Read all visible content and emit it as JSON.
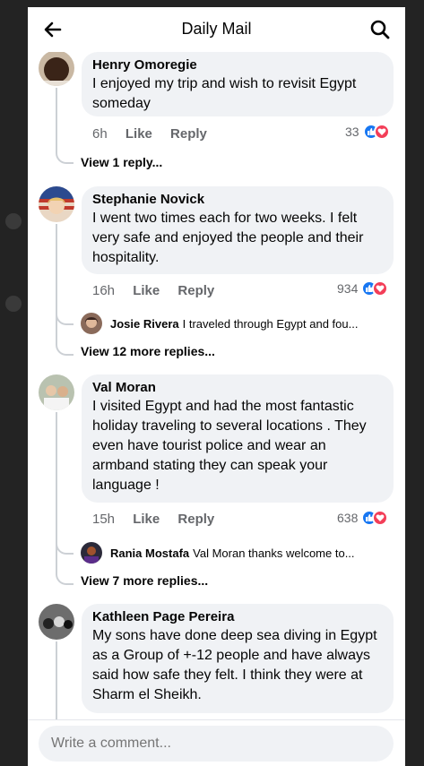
{
  "header": {
    "title": "Daily Mail",
    "back_icon": "arrow-left-icon",
    "search_icon": "search-icon"
  },
  "comments": [
    {
      "author": "Henry Omoregie",
      "text": "I enjoyed my trip and wish to revisit Egypt someday",
      "time": "6h",
      "like_label": "Like",
      "reply_label": "Reply",
      "reaction_count": "33",
      "view_replies": "View 1 reply..."
    },
    {
      "author": "Stephanie Novick",
      "text": "I went two times each for two weeks. I felt very safe and enjoyed the people and their hospitality.",
      "time": "16h",
      "like_label": "Like",
      "reply_label": "Reply",
      "reaction_count": "934",
      "reply_preview_author": "Josie Rivera",
      "reply_preview_text": "I traveled through Egypt and fou...",
      "view_replies": "View 12 more replies..."
    },
    {
      "author": "Val Moran",
      "text": "I visited Egypt and had the most fantastic holiday traveling to several locations . They even have tourist police and wear an armband stating they can speak your language !",
      "time": "15h",
      "like_label": "Like",
      "reply_label": "Reply",
      "reaction_count": "638",
      "reply_preview_author": "Rania Mostafa",
      "reply_preview_text": "Val Moran thanks welcome to...",
      "view_replies": "View 7 more replies..."
    },
    {
      "author": "Kathleen Page Pereira",
      "text": "My sons have done deep sea diving in Egypt as a Group of +-12 people and have always said how safe they felt.  I think they were at Sharm el Sheikh."
    }
  ],
  "composer": {
    "placeholder": "Write a comment..."
  },
  "colors": {
    "like_blue": "#1877f2",
    "love_red": "#f33e58",
    "bubble": "#f0f2f5",
    "meta_gray": "#65676b"
  }
}
